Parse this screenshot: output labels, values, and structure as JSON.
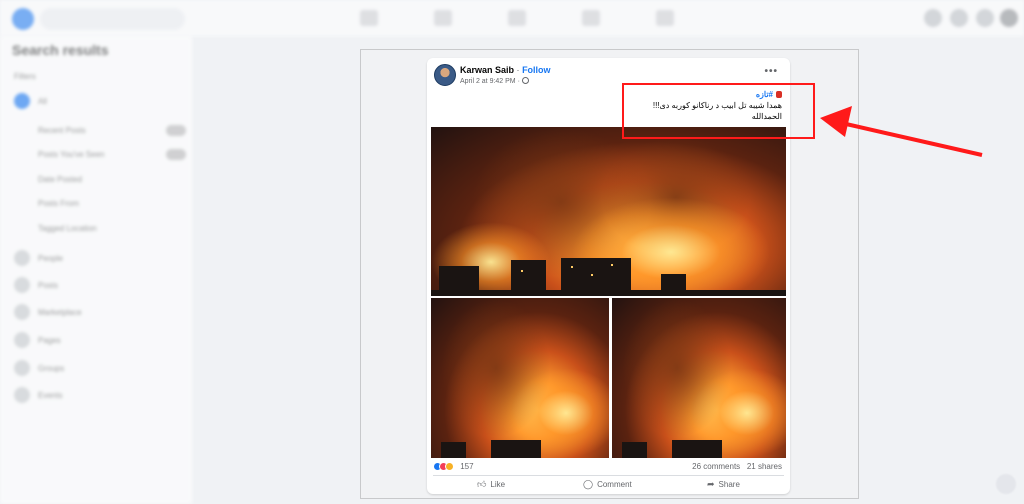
{
  "background": {
    "search_placeholder": "",
    "sidebar_title": "Search results",
    "sidebar_rows": [
      "Filters",
      "All",
      "Recent Posts",
      "Posts You've Seen",
      "Date Posted",
      "Posts From",
      "Tagged Location",
      "People",
      "Posts",
      "Marketplace",
      "Pages",
      "Groups",
      "Events"
    ]
  },
  "post": {
    "author": "Karwan Saib",
    "separator": "·",
    "follow_label": "Follow",
    "timestamp": "April 2 at 9:42 PM ·",
    "more_label": "•••",
    "hashtag": "#تازه",
    "text_line1": "همدا شیبه تل ابیب د رناکانو کوربه دی!!!",
    "text_line2": "الحمدالله",
    "reaction_count": "157",
    "comments": "26 comments",
    "shares": "21 shares",
    "like_label": "Like",
    "comment_label": "Comment",
    "share_label": "Share"
  },
  "colors": {
    "facebook_blue": "#1877f2",
    "annotation_red": "#ff1a1a"
  },
  "icons": {
    "like": "thumbs-up-icon",
    "comment": "comment-bubble-icon",
    "share": "share-arrow-icon",
    "privacy": "globe-icon"
  }
}
